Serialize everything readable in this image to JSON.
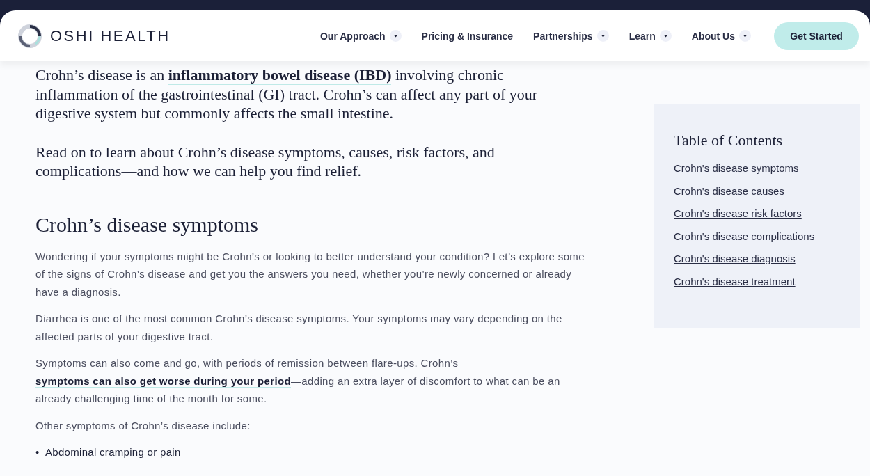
{
  "header": {
    "brand": "OSHI HEALTH",
    "nav": [
      {
        "label": "Our Approach",
        "dropdown": true
      },
      {
        "label": "Pricing & Insurance",
        "dropdown": false
      },
      {
        "label": "Partnerships",
        "dropdown": true
      },
      {
        "label": "Learn",
        "dropdown": true
      },
      {
        "label": "About Us",
        "dropdown": true
      }
    ],
    "cta": "Get Started"
  },
  "intro": [
    [
      {
        "kind": "text",
        "text": "Crohn’s disease is an "
      },
      {
        "kind": "link",
        "text": "inflammatory bowel disease (IBD)"
      },
      {
        "kind": "text",
        "text": " involving chronic inflammation of the gastrointestinal (GI) tract. Crohn’s can affect any part of your digestive system but commonly affects the small intestine."
      }
    ],
    [
      {
        "kind": "text",
        "text": "Read on to learn about Crohn’s disease symptoms, causes, risk factors, and complications—and how we can help you find relief."
      }
    ]
  ],
  "section": {
    "heading": "Crohn’s disease symptoms",
    "paragraphs": [
      [
        {
          "kind": "text",
          "text": "Wondering if your symptoms might be Crohn’s or looking to better understand your condition? Let’s explore some of the signs of Crohn’s disease and get you the answers you need, whether you’re newly concerned or already have a diagnosis."
        }
      ],
      [
        {
          "kind": "text",
          "text": "Diarrhea is one of the most common Crohn’s disease symptoms. Your symptoms may vary depending on the affected parts of your digestive tract."
        }
      ],
      [
        {
          "kind": "text",
          "text": "Symptoms can also come and go, with periods of remission between flare-ups. Crohn’s "
        },
        {
          "kind": "link",
          "text": "symptoms can also get worse during your period"
        },
        {
          "kind": "text",
          "text": "—adding an extra layer of discomfort to what can be an already challenging time of the month for some."
        }
      ],
      [
        {
          "kind": "text",
          "text": "Other symptoms of Crohn’s disease include:"
        }
      ]
    ],
    "bullets": [
      {
        "marker": "•",
        "text": "Abdominal cramping or pain"
      }
    ]
  },
  "toc": {
    "title": "Table of Contents",
    "links": [
      "Crohn's disease symptoms",
      "Crohn's disease causes",
      "Crohn's disease risk factors",
      "Crohn's disease complications",
      "Crohn's disease diagnosis",
      "Crohn's disease treatment"
    ]
  }
}
